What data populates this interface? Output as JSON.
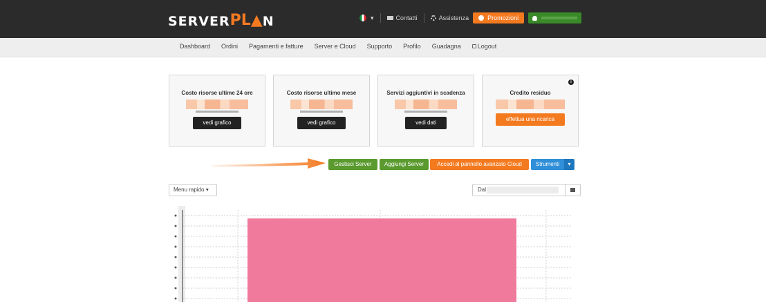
{
  "brand": {
    "server": "SERVER",
    "plan_a": "PL",
    "plan_b": "N"
  },
  "topbar": {
    "contacts": "Contatti",
    "assistance": "Assistenza",
    "promotions": "Promozioni"
  },
  "nav": {
    "items": [
      "Dashboard",
      "Ordini",
      "Pagamenti e fatture",
      "Server e Cloud",
      "Supporto",
      "Profilo",
      "Guadagna"
    ],
    "logout": "Logout"
  },
  "cards": [
    {
      "title": "Costo risorse ultime 24 ore",
      "button": "vedi grafico"
    },
    {
      "title": "Costo risorse ultimo mese",
      "button": "vedi grafico"
    },
    {
      "title": "Servizi aggiuntivi in scadenza",
      "button": "vedi dati"
    },
    {
      "title": "Credito residuo",
      "button": "effettua una ricarica"
    }
  ],
  "actions": {
    "manage_server": "Gestisci Server",
    "add_server": "Aggiungi Server",
    "cloud_panel": "Accedi al pannello avanzato Cloud",
    "tools": "Strumenti"
  },
  "filters": {
    "quick_menu": "Menu rapido",
    "date_label": "Dal"
  },
  "colors": {
    "orange": "#f47a20",
    "green": "#5a9a2e",
    "blue": "#2f8fd8",
    "bar": "#f07a9c"
  },
  "chart_data": {
    "type": "bar",
    "categories": [
      ""
    ],
    "values": [
      1
    ],
    "ylim": [
      0,
      1.1
    ]
  }
}
